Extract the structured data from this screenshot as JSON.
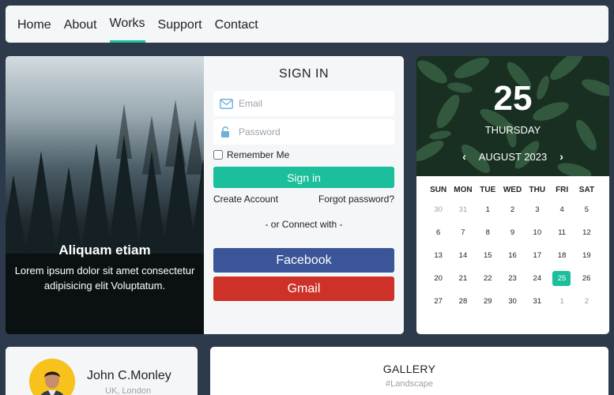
{
  "nav": {
    "items": [
      {
        "label": "Home",
        "active": false
      },
      {
        "label": "About",
        "active": false
      },
      {
        "label": "Works",
        "active": true
      },
      {
        "label": "Support",
        "active": false
      },
      {
        "label": "Contact",
        "active": false
      }
    ]
  },
  "hero": {
    "title": "Aliquam etiam",
    "text": "Lorem ipsum dolor sit amet consectetur adipisicing elit Voluptatum."
  },
  "signin": {
    "title": "SIGN IN",
    "email_placeholder": "Email",
    "password_placeholder": "Password",
    "remember_label": "Remember Me",
    "submit_label": "Sign in",
    "create_account": "Create Account",
    "forgot_password": "Forgot password?",
    "connect_label": "- or Connect with -",
    "facebook_label": "Facebook",
    "gmail_label": "Gmail"
  },
  "calendar": {
    "day": "25",
    "weekday": "THURSDAY",
    "month_label": "AUGUST 2023",
    "headers": [
      "SUN",
      "MON",
      "TUE",
      "WED",
      "THU",
      "FRI",
      "SAT"
    ],
    "weeks": [
      [
        {
          "d": "30",
          "m": true
        },
        {
          "d": "31",
          "m": true
        },
        {
          "d": "1"
        },
        {
          "d": "2"
        },
        {
          "d": "3"
        },
        {
          "d": "4"
        },
        {
          "d": "5"
        }
      ],
      [
        {
          "d": "6"
        },
        {
          "d": "7"
        },
        {
          "d": "8"
        },
        {
          "d": "9"
        },
        {
          "d": "10"
        },
        {
          "d": "11"
        },
        {
          "d": "12"
        }
      ],
      [
        {
          "d": "13"
        },
        {
          "d": "14"
        },
        {
          "d": "15"
        },
        {
          "d": "16"
        },
        {
          "d": "17"
        },
        {
          "d": "18"
        },
        {
          "d": "19"
        }
      ],
      [
        {
          "d": "20"
        },
        {
          "d": "21"
        },
        {
          "d": "22"
        },
        {
          "d": "23"
        },
        {
          "d": "24"
        },
        {
          "d": "25",
          "t": true
        },
        {
          "d": "26"
        }
      ],
      [
        {
          "d": "27"
        },
        {
          "d": "28"
        },
        {
          "d": "29"
        },
        {
          "d": "30"
        },
        {
          "d": "31"
        },
        {
          "d": "1",
          "m": true
        },
        {
          "d": "2",
          "m": true
        }
      ]
    ]
  },
  "profile": {
    "name": "John C.Monley",
    "location": "UK, London"
  },
  "gallery": {
    "title": "GALLERY",
    "subtitle": "#Landscape"
  },
  "colors": {
    "accent": "#1bbf9b",
    "facebook": "#3b5598",
    "gmail": "#cd3127",
    "background": "#2c3a4b"
  }
}
